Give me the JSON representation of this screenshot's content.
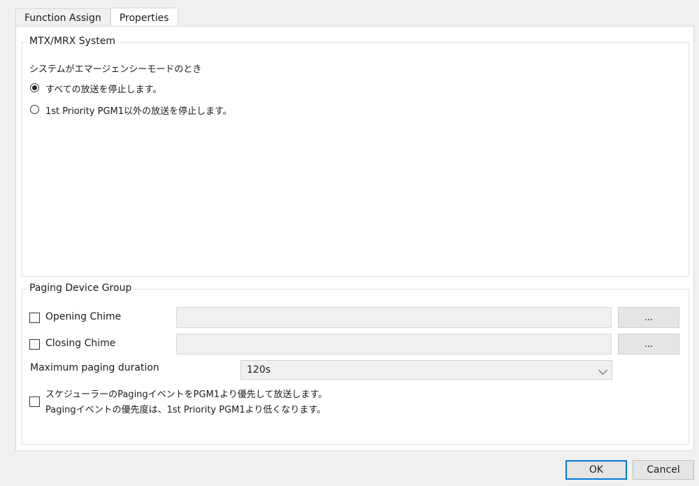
{
  "tabs": [
    {
      "label": "Function Assign"
    },
    {
      "label": "Properties"
    }
  ],
  "mtx_group": {
    "title": "MTX/MRX System",
    "prompt": "システムがエマージェンシーモードのとき",
    "options": [
      {
        "label": "すべての放送を停止します。",
        "selected": true
      },
      {
        "label": "1st Priority PGM1以外の放送を停止します。",
        "selected": false
      }
    ]
  },
  "paging_group": {
    "title": "Paging Device Group",
    "opening_chime": {
      "label": "Opening Chime",
      "checked": false,
      "value": "",
      "browse_label": "..."
    },
    "closing_chime": {
      "label": "Closing Chime",
      "checked": false,
      "value": "",
      "browse_label": "..."
    },
    "max_duration": {
      "label": "Maximum paging duration",
      "value": "120s"
    },
    "scheduler_priority": {
      "checked": false,
      "line1": "スケジューラーのPagingイベントをPGM1より優先して放送します。",
      "line2": "Pagingイベントの優先度は、1st Priority PGM1より低くなります。"
    }
  },
  "footer": {
    "ok_label": "OK",
    "cancel_label": "Cancel"
  }
}
